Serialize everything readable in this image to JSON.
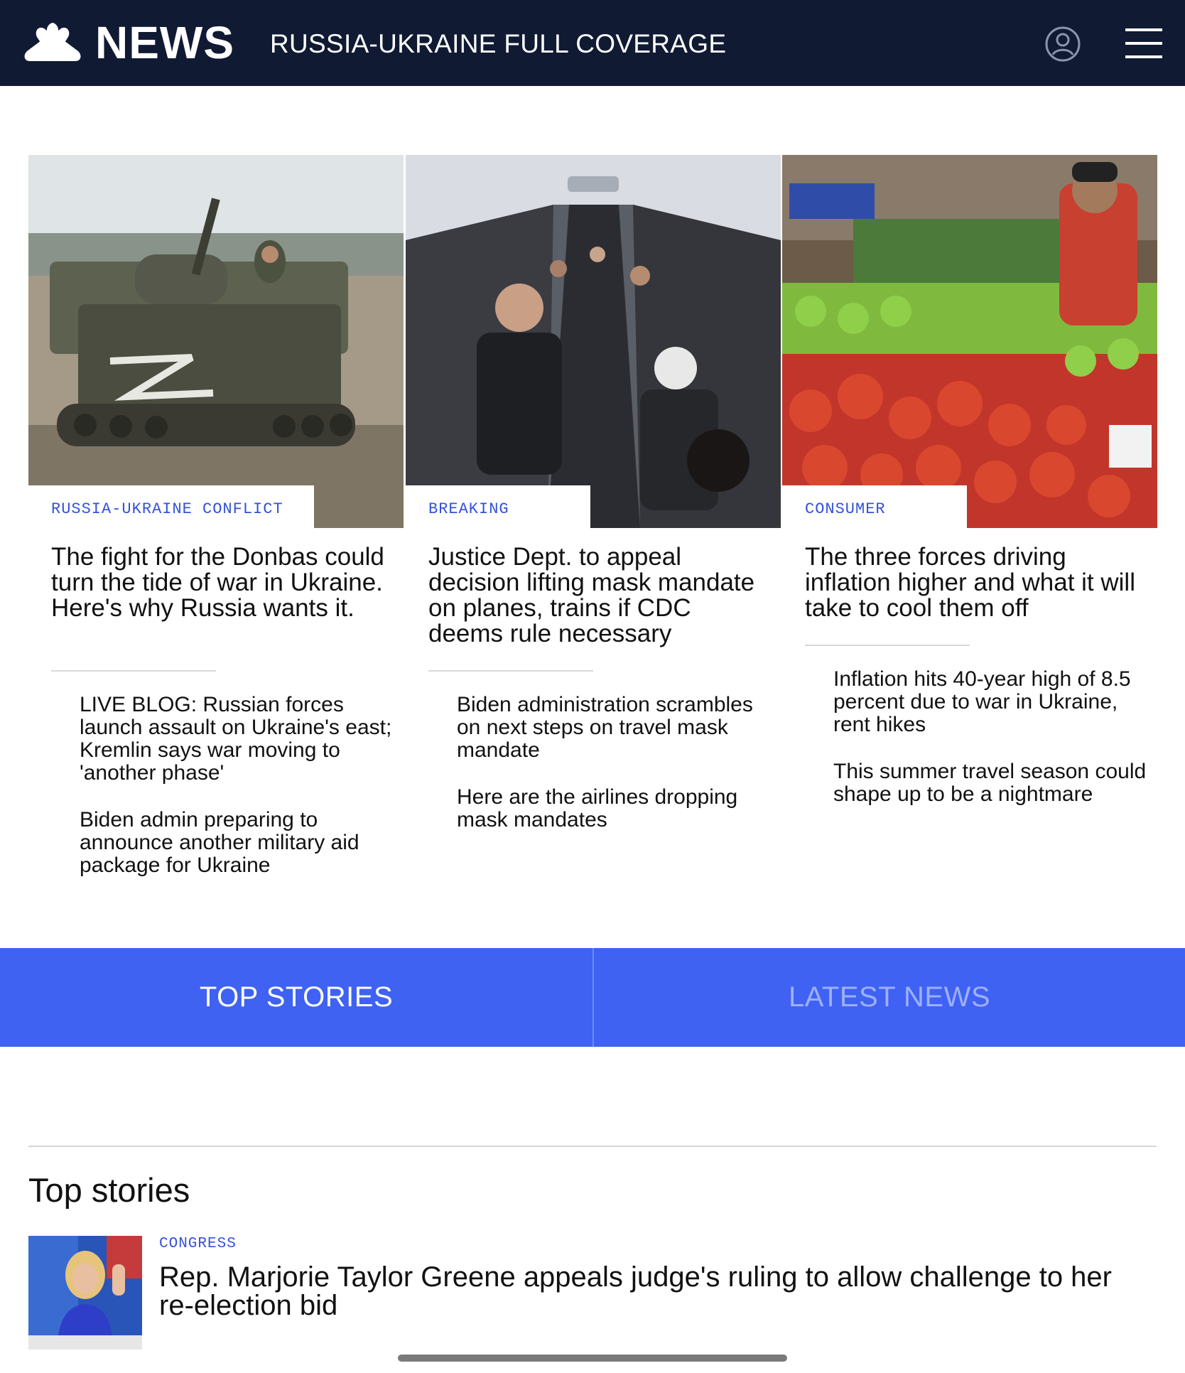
{
  "header": {
    "logo_text": "NEWS",
    "section_title": "RUSSIA-UKRAINE FULL COVERAGE",
    "account_icon": "account-circle-icon",
    "menu_icon": "hamburger-menu-icon"
  },
  "cards": [
    {
      "eyebrow": "RUSSIA-UKRAINE CONFLICT",
      "headline": "The fight for the Donbas could turn the tide of war in Ukraine. Here's why Russia wants it.",
      "related": [
        "LIVE BLOG: Russian forces launch assault on Ukraine's east; Kremlin says war moving to 'another phase'",
        "Biden admin preparing to announce another military aid package for Ukraine"
      ]
    },
    {
      "eyebrow": "BREAKING",
      "headline": "Justice Dept. to appeal decision lifting mask mandate on planes, trains if CDC deems rule necessary",
      "related": [
        "Biden administration scrambles on next steps on travel mask mandate",
        "Here are the airlines dropping mask mandates"
      ]
    },
    {
      "eyebrow": "CONSUMER",
      "headline": "The three forces driving inflation higher and what it will take to cool them off",
      "related": [
        "Inflation hits 40-year high of 8.5 percent due to war in Ukraine, rent hikes",
        "This summer travel season could shape up to be a nightmare"
      ]
    }
  ],
  "tabs": {
    "top_stories": "TOP STORIES",
    "latest_news": "LATEST NEWS",
    "active": "top_stories"
  },
  "top_stories": {
    "title": "Top stories",
    "items": [
      {
        "eyebrow": "CONGRESS",
        "headline": "Rep. Marjorie Taylor Greene appeals judge's ruling to allow challenge to her re-election bid"
      }
    ]
  },
  "colors": {
    "header_bg": "#101a33",
    "accent_blue": "#3f62f2",
    "eyebrow_blue": "#3452d9"
  }
}
